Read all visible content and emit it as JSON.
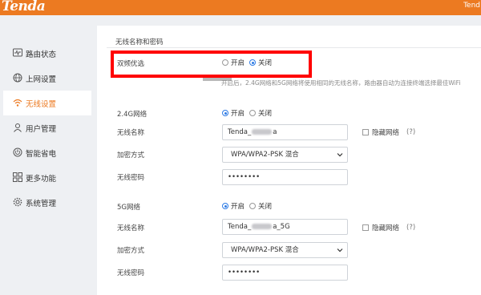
{
  "header": {
    "brand": "Tenda",
    "user_text": "Tend"
  },
  "sidebar": {
    "items": [
      {
        "label": "路由状态",
        "icon": "status-monitor-icon",
        "active": false
      },
      {
        "label": "上网设置",
        "icon": "globe-icon",
        "active": false
      },
      {
        "label": "无线设置",
        "icon": "wifi-icon",
        "active": true
      },
      {
        "label": "用户管理",
        "icon": "user-icon",
        "active": false
      },
      {
        "label": "智能省电",
        "icon": "power-icon",
        "active": false
      },
      {
        "label": "更多功能",
        "icon": "grid-icon",
        "active": false
      },
      {
        "label": "系统管理",
        "icon": "gear-icon",
        "active": false
      }
    ]
  },
  "wireless": {
    "section_title": "无线名称和密码",
    "dual_band": {
      "label": "双频优选",
      "on_label": "开启",
      "off_label": "关闭",
      "selected": "off",
      "hint": "开启后，2.4G网络和5G网络将使用相同的无线名称，路由器自动为连接终端选择最佳WiFi"
    },
    "band_24": {
      "label": "2.4G网络",
      "on_label": "开启",
      "off_label": "关闭",
      "selected": "on",
      "ssid_label": "无线名称",
      "ssid_prefix": "Tenda_",
      "ssid_suffix": "a",
      "hide_label": "隐藏网络",
      "help": "(?)",
      "security_label": "加密方式",
      "security_value": "WPA/WPA2-PSK 混合",
      "password_label": "无线密码",
      "password_value": "••••••••"
    },
    "band_5": {
      "label": "5G网络",
      "on_label": "开启",
      "off_label": "关闭",
      "selected": "on",
      "ssid_label": "无线名称",
      "ssid_prefix": "Tenda_",
      "ssid_suffix": "a_5G",
      "hide_label": "隐藏网络",
      "help": "(?)",
      "security_label": "加密方式",
      "security_value": "WPA/WPA2-PSK 混合",
      "password_label": "无线密码",
      "password_value": "••••••••"
    }
  },
  "colors": {
    "brand": "#ec7a21",
    "radio_selected": "#2d7be5",
    "highlight": "#ff0000"
  }
}
